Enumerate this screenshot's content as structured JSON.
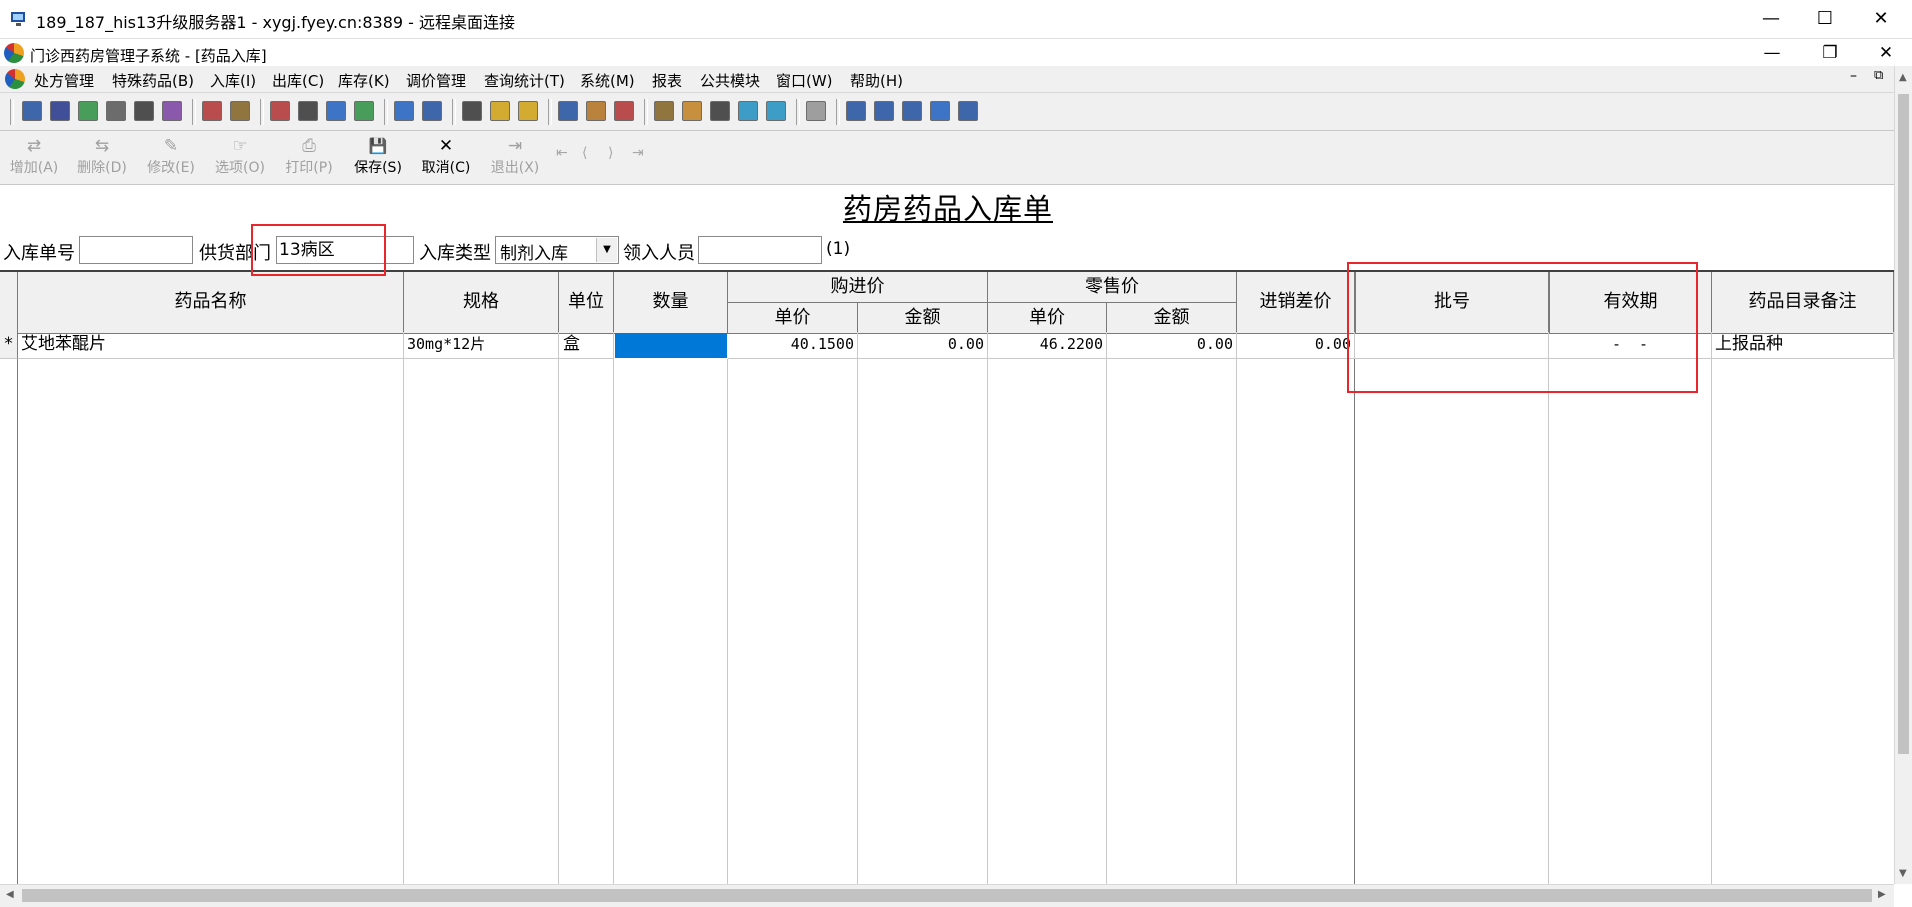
{
  "window": {
    "title": "189_187_his13升级服务器1 - xygj.fyey.cn:8389 - 远程桌面连接",
    "minimize_glyph": "—",
    "maximize_glyph": "☐",
    "close_glyph": "✕"
  },
  "mdi": {
    "title": "门诊西药房管理子系统 - [药品入库]",
    "minimize_glyph": "—",
    "restore_glyph": "❐",
    "close_glyph": "✕",
    "inner_minimize_glyph": "–",
    "inner_restore_glyph": "⧉"
  },
  "menu": [
    "处方管理",
    "特殊药品(B)",
    "入库(I)",
    "出库(C)",
    "库存(K)",
    "调价管理",
    "查询统计(T)",
    "系统(M)",
    "报表",
    "公共模块",
    "窗口(W)",
    "帮助(H)"
  ],
  "toolbar_icons": [
    {
      "name": "printer-icon",
      "color": "#1f4fa0"
    },
    {
      "name": "bottle-icon",
      "color": "#223388"
    },
    {
      "name": "check-box-icon",
      "color": "#2a8f3f"
    },
    {
      "name": "register-icon",
      "color": "#555555"
    },
    {
      "name": "binoculars-icon",
      "color": "#333333"
    },
    {
      "name": "list-icon",
      "color": "#7a3f9f"
    },
    {
      "name": "edit-doc-icon",
      "color": "#b03030"
    },
    {
      "name": "card-icon",
      "color": "#806020"
    },
    {
      "name": "book-icon",
      "color": "#b03030"
    },
    {
      "name": "checklist-icon",
      "color": "#333333"
    },
    {
      "name": "copy-icon",
      "color": "#1f5fbf"
    },
    {
      "name": "export-icon",
      "color": "#2a8f3f"
    },
    {
      "name": "note-icon",
      "color": "#1f5fbf"
    },
    {
      "name": "chart-icon",
      "color": "#1f4fa0"
    },
    {
      "name": "grid-icon",
      "color": "#333333"
    },
    {
      "name": "bell-icon",
      "color": "#d0a010"
    },
    {
      "name": "yellow-doc-icon",
      "color": "#d0a010"
    },
    {
      "name": "cup-icon",
      "color": "#1f4fa0"
    },
    {
      "name": "key-icon",
      "color": "#b07020"
    },
    {
      "name": "truck-icon",
      "color": "#b03030"
    },
    {
      "name": "folder-icon",
      "color": "#806020"
    },
    {
      "name": "thermometer-icon",
      "color": "#c08020"
    },
    {
      "name": "search-icon",
      "color": "#333333"
    },
    {
      "name": "calculator-icon",
      "color": "#1f8fbf"
    },
    {
      "name": "house-icon",
      "color": "#1f8fbf"
    },
    {
      "name": "stop-icon",
      "color": "#909090"
    },
    {
      "name": "zoom-icon",
      "color": "#1f4fa0"
    },
    {
      "name": "table-icon",
      "color": "#1f4fa0"
    },
    {
      "name": "windows-icon",
      "color": "#1f4fa0"
    },
    {
      "name": "checkmark-doc-icon",
      "color": "#1f5fbf"
    },
    {
      "name": "clipboard-icon",
      "color": "#1f4fa0"
    }
  ],
  "actions": {
    "add": {
      "label": "增加(A)",
      "glyph": "⇄"
    },
    "delete": {
      "label": "删除(D)",
      "glyph": "⇆"
    },
    "modify": {
      "label": "修改(E)",
      "glyph": "✎"
    },
    "options": {
      "label": "选项(O)",
      "glyph": "☞"
    },
    "print": {
      "label": "打印(P)",
      "glyph": "⎙"
    },
    "save": {
      "label": "保存(S)",
      "glyph": "💾"
    },
    "cancel": {
      "label": "取消(C)",
      "glyph": "✕"
    },
    "exit": {
      "label": "退出(X)",
      "glyph": "⇥"
    },
    "nav_first": "⇤",
    "nav_prev": "⟨",
    "nav_next": "⟩",
    "nav_last": "⇥"
  },
  "form": {
    "title": "药房药品入库单",
    "receipt_no_label": "入库单号",
    "receipt_no_value": "",
    "supplier_label": "供货部门",
    "supplier_value": "13病区",
    "type_label": "入库类型",
    "type_value": "制剂入库",
    "receiver_label": "领入人员",
    "receiver_value": "",
    "record_count": "(1)"
  },
  "grid": {
    "headers": {
      "name": "药品名称",
      "spec": "规格",
      "unit": "单位",
      "qty": "数量",
      "purchase_group": "购进价",
      "purchase_unit_price": "单价",
      "purchase_amount": "金额",
      "retail_group": "零售价",
      "retail_unit_price": "单价",
      "retail_amount": "金额",
      "diff": "进销差价",
      "batch": "批号",
      "expiry": "有效期",
      "catalog_note": "药品目录备注"
    },
    "rows": [
      {
        "marker": "*",
        "name": "艾地苯醌片",
        "spec": "30mg*12片",
        "unit": "盒",
        "qty": "",
        "purchase_unit_price": "40.1500",
        "purchase_amount": "0.00",
        "retail_unit_price": "46.2200",
        "retail_amount": "0.00",
        "diff": "0.00",
        "batch": "",
        "expiry": "-  -",
        "catalog_note": "上报品种"
      }
    ]
  },
  "scroll": {
    "up": "▲",
    "down": "▼",
    "left": "◀",
    "right": "▶"
  },
  "colors": {
    "highlight_box": "#e8262c",
    "selected_cell": "#0078d7",
    "chrome": "#f0f0f0"
  }
}
